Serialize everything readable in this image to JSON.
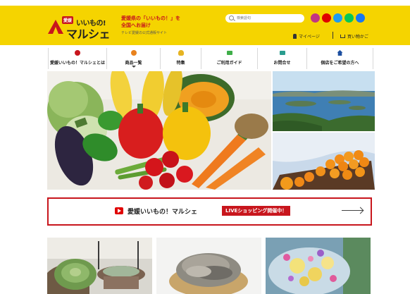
{
  "header": {
    "logo_badge": "愛媛",
    "logo_top": "いいもの!",
    "logo_main": "マルシェ",
    "tagline_line1": "愛媛県の「いいもの！」を",
    "tagline_line2": "全国へお届け",
    "tagline_sub": "テレビ愛媛の公式通販サイト",
    "search_placeholder": "検索語句",
    "mypage_label": "マイページ",
    "cart_label": "買い物かご",
    "social": [
      "instagram-icon",
      "youtube-icon",
      "twitter-icon",
      "line-icon",
      "facebook-icon"
    ]
  },
  "nav": {
    "items": [
      {
        "label": "愛媛いいもの！マルシェとは",
        "icon": "info-icon",
        "color": "#c8161d"
      },
      {
        "label": "商品一覧",
        "icon": "orange-icon",
        "color": "#e8821e"
      },
      {
        "label": "特集",
        "icon": "lightbulb-icon",
        "color": "#e6b422"
      },
      {
        "label": "ご利用ガイド",
        "icon": "book-icon",
        "color": "#3fae49"
      },
      {
        "label": "お問合せ",
        "icon": "mail-icon",
        "color": "#2a9d8f"
      },
      {
        "label": "個店をご希望の方へ",
        "icon": "home-icon",
        "color": "#1d4fa0"
      }
    ]
  },
  "banner": {
    "title": "愛媛いいもの！マルシェ",
    "live_label": "LIVEショッピング開催中！"
  },
  "colors": {
    "brand_yellow": "#f5d400",
    "brand_red": "#c8161d"
  }
}
